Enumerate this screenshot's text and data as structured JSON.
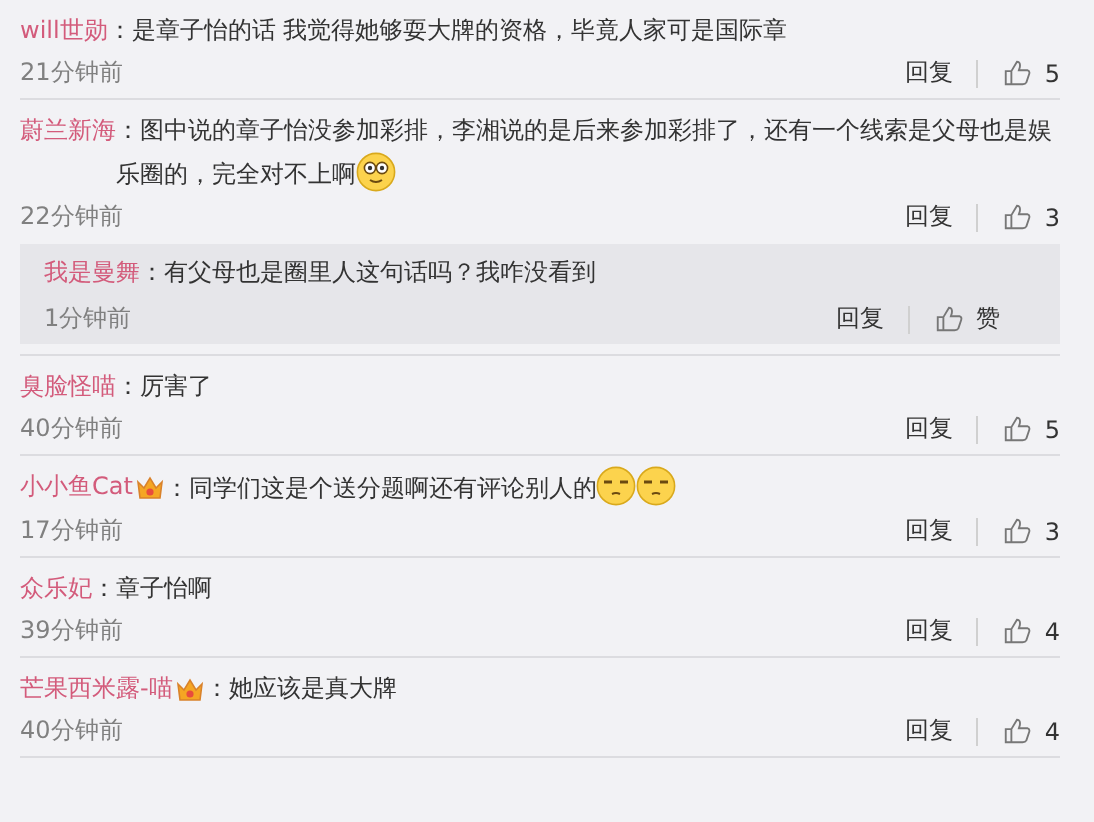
{
  "comments": [
    {
      "user": "will世勋",
      "text": "：是章子怡的话 我觉得她够耍大牌的资格，毕竟人家可是国际章",
      "time": "21分钟前",
      "reply": "回复",
      "likes": "5"
    },
    {
      "user": "蔚兰新海",
      "text": "：图中说的章子怡没参加彩排，李湘说的是后来参加彩排了，还有一个线索是父母也是娱乐圈的，完全对不上啊",
      "emojis": [
        {
          "kind": "wide-eyed"
        }
      ],
      "time": "22分钟前",
      "reply": "回复",
      "likes": "3",
      "replies": [
        {
          "user": "我是曼舞",
          "text": "：有父母也是圈里人这句话吗？我咋没看到",
          "time": "1分钟前",
          "reply": "回复",
          "likes": "赞"
        }
      ]
    },
    {
      "user": "臭脸怪喵",
      "text": "：厉害了",
      "time": "40分钟前",
      "reply": "回复",
      "likes": "5"
    },
    {
      "user": "小小鱼Cat",
      "badge": true,
      "text": "：同学们这是个送分题啊还有评论别人的",
      "emojis": [
        {
          "kind": "smug"
        },
        {
          "kind": "smug"
        }
      ],
      "time": "17分钟前",
      "reply": "回复",
      "likes": "3"
    },
    {
      "user": "众乐妃",
      "text": "：章子怡啊",
      "time": "39分钟前",
      "reply": "回复",
      "likes": "4"
    },
    {
      "user": "芒果西米露-喵",
      "badge": true,
      "text": "：她应该是真大牌",
      "time": "40分钟前",
      "reply": "回复",
      "likes": "4"
    }
  ]
}
